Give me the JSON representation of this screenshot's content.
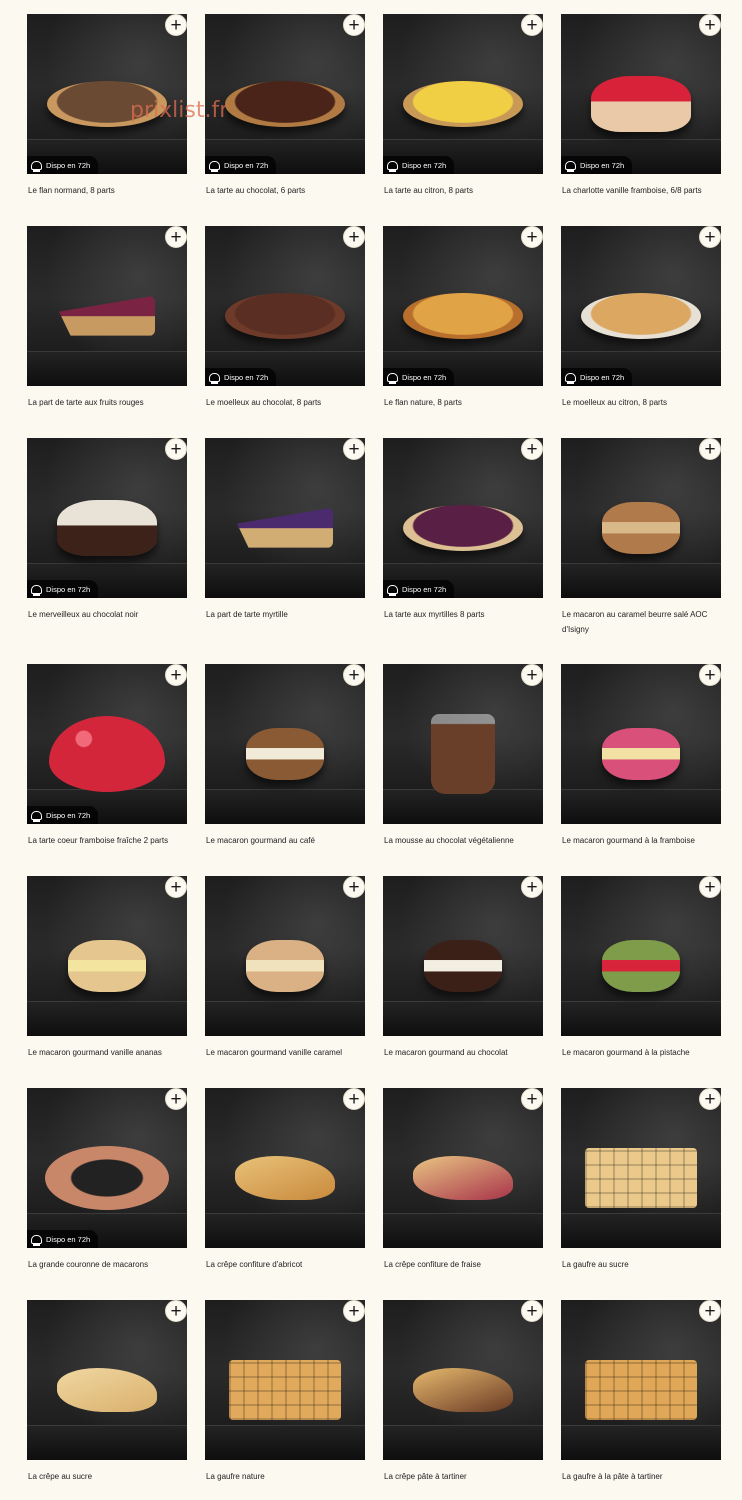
{
  "watermark": "prixlist.fr",
  "add_label": "+",
  "products": [
    {
      "name": "Le flan normand, 8 parts",
      "badge": "Dispo en 72h",
      "kind": "tart",
      "c1": "#6b4a34",
      "c2": "#c9985e"
    },
    {
      "name": "La tarte au chocolat, 6 parts",
      "badge": "Dispo en 72h",
      "kind": "tart",
      "c1": "#4a2418",
      "c2": "#b07a42"
    },
    {
      "name": "La tarte au citron, 8 parts",
      "badge": "Dispo en 72h",
      "kind": "tart",
      "c1": "#f1cf45",
      "c2": "#c99a55"
    },
    {
      "name": "La charlotte vanille framboise, 6/8 parts",
      "badge": "Dispo en 72h",
      "kind": "cake",
      "c1": "#d8223a",
      "c2": "#e9c9a8"
    },
    {
      "name": "La part de tarte aux fruits rouges",
      "badge": "",
      "kind": "slice",
      "c1": "#7a2342",
      "c2": "#c79a62"
    },
    {
      "name": "Le moelleux au chocolat, 8 parts",
      "badge": "Dispo en 72h",
      "kind": "tart",
      "c1": "#5a2e22",
      "c2": "#6e3a2a"
    },
    {
      "name": "Le flan nature, 8 parts",
      "badge": "Dispo en 72h",
      "kind": "tart",
      "c1": "#e0a447",
      "c2": "#b86f2c"
    },
    {
      "name": "Le moelleux au citron, 8 parts",
      "badge": "Dispo en 72h",
      "kind": "tart",
      "c1": "#dca761",
      "c2": "#e7e0d4"
    },
    {
      "name": "Le merveilleux au chocolat noir",
      "badge": "Dispo en 72h",
      "kind": "cake",
      "c1": "#e9e2d6",
      "c2": "#3d2219"
    },
    {
      "name": "La part de tarte myrtille",
      "badge": "",
      "kind": "slice",
      "c1": "#4b2a6e",
      "c2": "#d2ad73"
    },
    {
      "name": "La tarte aux myrtilles 8 parts",
      "badge": "Dispo en 72h",
      "kind": "tart",
      "c1": "#5a1f44",
      "c2": "#dcc093"
    },
    {
      "name": "Le macaron au caramel beurre salé AOC d'Isigny",
      "badge": "",
      "kind": "macaron",
      "c1": "#b07a4a",
      "c2": "#d9b88a"
    },
    {
      "name": "La tarte coeur framboise fraîche 2 parts",
      "badge": "Dispo en 72h",
      "kind": "heart",
      "c1": "#d4263b",
      "c2": "#f06a7a"
    },
    {
      "name": "Le macaron gourmand au café",
      "badge": "",
      "kind": "macaron",
      "c1": "#8a5a34",
      "c2": "#f1ead9"
    },
    {
      "name": "La mousse au chocolat végétalienne",
      "badge": "",
      "kind": "cup",
      "c1": "#6a3f2a",
      "c2": "#6a3f2a"
    },
    {
      "name": "Le macaron gourmand à la framboise",
      "badge": "",
      "kind": "macaron",
      "c1": "#d9517a",
      "c2": "#f2e1a2"
    },
    {
      "name": "Le macaron gourmand vanille ananas",
      "badge": "",
      "kind": "macaron",
      "c1": "#e5c68f",
      "c2": "#f3e4a0"
    },
    {
      "name": "Le macaron gourmand vanille caramel",
      "badge": "",
      "kind": "macaron",
      "c1": "#d9b184",
      "c2": "#f0e2bc"
    },
    {
      "name": "Le macaron gourmand au chocolat",
      "badge": "",
      "kind": "macaron",
      "c1": "#3b2018",
      "c2": "#f3eee2"
    },
    {
      "name": "Le macaron gourmand à la pistache",
      "badge": "",
      "kind": "macaron",
      "c1": "#7f9c4a",
      "c2": "#d8243a"
    },
    {
      "name": "La grande couronne de macarons",
      "badge": "Dispo en 72h",
      "kind": "crown",
      "c1": "#c9876a",
      "c2": "#c9876a"
    },
    {
      "name": "La crêpe confiture d'abricot",
      "badge": "",
      "kind": "crepe",
      "c1": "#e8c27a",
      "c2": "#c98a3c"
    },
    {
      "name": "La crêpe confiture de fraise",
      "badge": "",
      "kind": "crepe",
      "c1": "#e9c584",
      "c2": "#a8344a"
    },
    {
      "name": "La gaufre au sucre",
      "badge": "",
      "kind": "waffle",
      "c1": "#eac98b",
      "c2": "#eac98b"
    },
    {
      "name": "La crêpe au sucre",
      "badge": "",
      "kind": "crepe",
      "c1": "#f0d7a2",
      "c2": "#d9b06c"
    },
    {
      "name": "La gaufre nature",
      "badge": "",
      "kind": "waffle",
      "c1": "#e0a95c",
      "c2": "#e0a95c"
    },
    {
      "name": "La crêpe pâte à tartiner",
      "badge": "",
      "kind": "crepe",
      "c1": "#e6b96e",
      "c2": "#6a3a24"
    },
    {
      "name": "La gaufre à la pâte à tartiner",
      "badge": "",
      "kind": "waffle",
      "c1": "#dfa757",
      "c2": "#dfa757"
    }
  ]
}
